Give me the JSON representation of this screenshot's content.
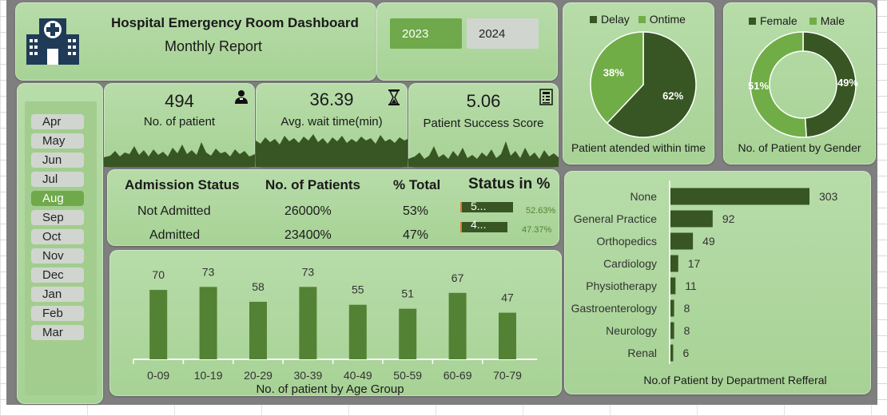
{
  "header": {
    "title": "Hospital Emergency Room Dashboard",
    "subtitle": "Monthly Report",
    "icon": "hospital-icon"
  },
  "years": [
    {
      "label": "2023",
      "selected": true
    },
    {
      "label": "2024",
      "selected": false
    }
  ],
  "months": [
    {
      "label": "Apr",
      "selected": false
    },
    {
      "label": "May",
      "selected": false
    },
    {
      "label": "Jun",
      "selected": false
    },
    {
      "label": "Jul",
      "selected": false
    },
    {
      "label": "Aug",
      "selected": true
    },
    {
      "label": "Sep",
      "selected": false
    },
    {
      "label": "Oct",
      "selected": false
    },
    {
      "label": "Nov",
      "selected": false
    },
    {
      "label": "Dec",
      "selected": false
    },
    {
      "label": "Jan",
      "selected": false
    },
    {
      "label": "Feb",
      "selected": false
    },
    {
      "label": "Mar",
      "selected": false
    }
  ],
  "kpis": {
    "patients": {
      "value": "494",
      "label": "No. of patient",
      "icon": "person-icon"
    },
    "wait": {
      "value": "36.39",
      "label": "Avg. wait time(min)",
      "icon": "hourglass-icon"
    },
    "score": {
      "value": "5.06",
      "label": "Patient Success Score",
      "icon": "clipboard-icon"
    }
  },
  "admission": {
    "headers": [
      "Admission Status",
      "No. of Patients",
      "% Total",
      "Status in %"
    ],
    "rows": [
      {
        "status": "Not Admitted",
        "patients": "26000%",
        "pct": "53%",
        "bar_text": "5...",
        "bar_pct": "52.63%",
        "bar_value": 0.5263
      },
      {
        "status": "Admitted",
        "patients": "23400%",
        "pct": "47%",
        "bar_text": "4...",
        "bar_pct": "47.37%",
        "bar_value": 0.4737
      }
    ]
  },
  "colors": {
    "dark": "#375623",
    "mid": "#548235",
    "light": "#70ad47",
    "card": "#a9d18e"
  },
  "chart_data": [
    {
      "type": "pie",
      "title": "Patient atended within time",
      "legend_position": "top",
      "categories": [
        "Delay",
        "Ontime"
      ],
      "values": [
        62,
        38
      ],
      "labels": [
        "62%",
        "38%"
      ]
    },
    {
      "type": "pie",
      "donut": true,
      "title": "No. of Patient by Gender",
      "legend_position": "top",
      "categories": [
        "Female",
        "Male"
      ],
      "values": [
        49,
        51
      ],
      "labels": [
        "49%",
        "51%"
      ]
    },
    {
      "type": "bar",
      "title": "No. of patient by Age Group",
      "categories": [
        "0-09",
        "10-19",
        "20-29",
        "30-39",
        "40-49",
        "50-59",
        "60-69",
        "70-79"
      ],
      "values": [
        70,
        73,
        58,
        73,
        55,
        51,
        67,
        47
      ],
      "ylim": [
        0,
        80
      ]
    },
    {
      "type": "bar",
      "orientation": "horizontal",
      "title": "No.of Patient by Department Refferal",
      "categories": [
        "None",
        "General Practice",
        "Orthopedics",
        "Cardiology",
        "Physiotherapy",
        "Gastroenterology",
        "Neurology",
        "Renal"
      ],
      "values": [
        303,
        92,
        49,
        17,
        11,
        8,
        8,
        6
      ],
      "xlim": [
        0,
        310
      ]
    }
  ]
}
